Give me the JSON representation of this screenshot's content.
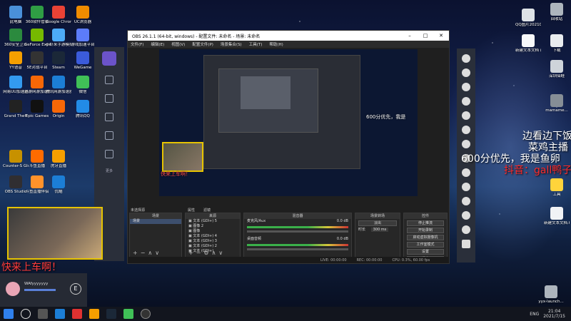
{
  "desktop_icons_left": [
    {
      "label": "此电脑",
      "color": "#4a90d9"
    },
    {
      "label": "360软件管家",
      "color": "#2f9e44"
    },
    {
      "label": "Google Chrome",
      "color": "#e94235"
    },
    {
      "label": "UC浏览器",
      "color": "#f08c00"
    },
    {
      "label": "360安全卫士",
      "color": "#2b8a3e"
    },
    {
      "label": "GeForce Experience",
      "color": "#76b900"
    },
    {
      "label": "小虾米手游模拟器",
      "color": "#4dabf7"
    },
    {
      "label": "游戏加速平台",
      "color": "#5c7cfa"
    },
    {
      "label": "YY语音",
      "color": "#f59f00"
    },
    {
      "label": "5E对战平台",
      "color": "#333"
    },
    {
      "label": "Steam",
      "color": "#1b2838"
    },
    {
      "label": "WeGame",
      "color": "#3b5bdb"
    },
    {
      "label": "网易UU加速器",
      "color": "#339af0"
    },
    {
      "label": "迅游网游加速器",
      "color": "#f76707"
    },
    {
      "label": "腾讯网游加速器",
      "color": "#1c7ed6"
    },
    {
      "label": "微信",
      "color": "#40c057"
    },
    {
      "label": "Grand Theft",
      "color": "#222"
    },
    {
      "label": "Epic Games",
      "color": "#111"
    },
    {
      "label": "Origin",
      "color": "#f76707"
    },
    {
      "label": "腾讯QQ",
      "color": "#228be6"
    },
    {
      "label": "Counter-S Global Off...",
      "color": "#c79100"
    },
    {
      "label": "斗鱼直播",
      "color": "#ff6b00"
    },
    {
      "label": "虎牙直播",
      "color": "#f59f00"
    },
    {
      "label": "OBS Studio",
      "color": "#302e31"
    },
    {
      "label": "斗鱼直播伴侣",
      "color": "#ff922b"
    },
    {
      "label": "优酷",
      "color": "#1c7ed6"
    }
  ],
  "desktop_icons_right": [
    {
      "label": "回收站",
      "color": "#adb5bd"
    },
    {
      "label": "QQ图片20210712...",
      "color": "#dee2e6"
    },
    {
      "label": "新建文本文档 (2)",
      "color": "#f8f9fa"
    },
    {
      "label": "下载",
      "color": "#e9ecef"
    },
    {
      "label": "深圳仙蛙",
      "color": "#ced4da"
    },
    {
      "label": "mamame...",
      "color": "#868e96"
    },
    {
      "label": "工具",
      "color": "#ffd43b"
    },
    {
      "label": "新建文本文档.txt",
      "color": "#f1f3f5"
    },
    {
      "label": "yyx-launch...",
      "color": "#adb5bd"
    }
  ],
  "obs": {
    "title": "OBS 26.1.1 (64-bit, windows) - 配置文件: 未命名 - 场景: 未命名",
    "menu": [
      "文件(F)",
      "编辑(E)",
      "视图(V)",
      "配置文件(P)",
      "场景集合(S)",
      "工具(T)",
      "帮助(H)"
    ],
    "source_unselected": "未选择源",
    "tab_properties": "属性",
    "tab_filters": "滤镜",
    "panels": {
      "scenes_header": "场景",
      "scenes": [
        "场景"
      ],
      "sources_header": "来源",
      "sources": [
        "文本 (GDI+) 5",
        "图像 2",
        "图像",
        "文本 (GDI+) 4",
        "文本 (GDI+) 3",
        "文本 (GDI+) 2",
        "文本 (GDI+)"
      ],
      "mixer_header": "混音器",
      "mixer_tracks": [
        {
          "name": "麦克风/Aux",
          "db": "0.0 dB"
        },
        {
          "name": "桌面音频",
          "db": "0.0 dB"
        }
      ],
      "transition_header": "场景转场",
      "transition_type": "淡出",
      "transition_duration_label": "时长",
      "transition_duration": "300 ms",
      "controls_header": "控件",
      "controls": [
        "停止推流",
        "开始录制",
        "启动虚拟摄像机",
        "工作室模式",
        "设置",
        "退出"
      ]
    },
    "status": {
      "live": "LIVE: 00:00:00",
      "rec": "REC: 00:00:00",
      "cpu": "CPU: 0.3%, 60.00 fps"
    }
  },
  "overlays": {
    "top_right_1": "边看边下饭",
    "top_right_2": "菜鸡主播",
    "top_right_3": "600分优先，我是鱼卵",
    "top_right_4": "抖音：gall鸭子",
    "bottom_left": "快来上车啊！",
    "preview_text_1": "600分优先，我是",
    "preview_text_2": "快来上车啊！"
  },
  "profile": {
    "name": "WAfyyyyyyy",
    "badge": "E"
  },
  "left_dock_label": "更多",
  "taskbar": {
    "lang": "ENG",
    "time": "21:04",
    "date": "2021/7/15"
  }
}
